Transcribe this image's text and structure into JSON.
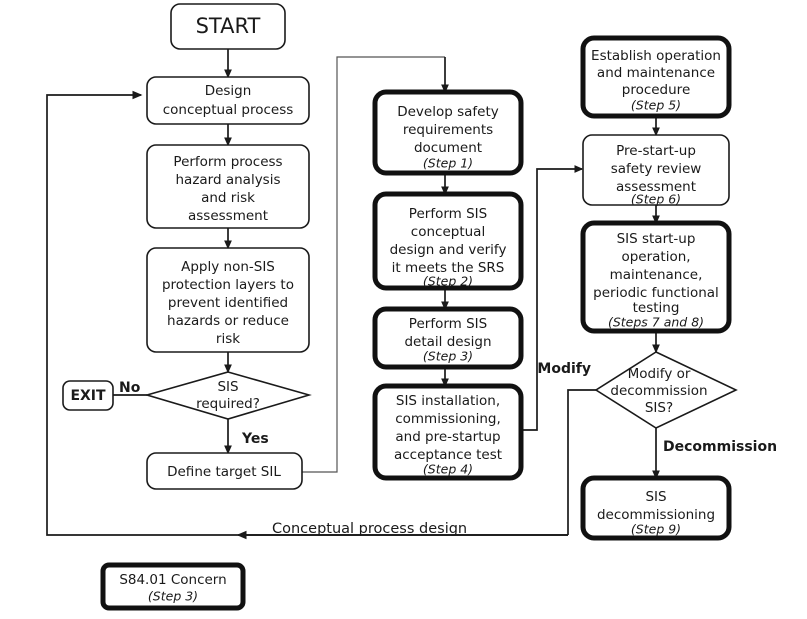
{
  "title": "SIS Safety Lifecycle Flowchart",
  "colors": {
    "background": "#ffffff",
    "stroke": "#1a1a1a",
    "thick_stroke": "#111111",
    "fill": "#ffffff",
    "text": "#1a1a1a"
  },
  "nodes": {
    "start": {
      "label": "START",
      "shape": "rounded-rect",
      "border": "thin"
    },
    "design_conceptual": {
      "lines": [
        "Design",
        "conceptual process"
      ],
      "shape": "rounded-rect",
      "border": "thin"
    },
    "hazard_analysis": {
      "lines": [
        "Perform process",
        "hazard analysis",
        "and risk",
        "assessment"
      ],
      "shape": "rounded-rect",
      "border": "thin"
    },
    "protection_layers": {
      "lines": [
        "Apply non-SIS",
        "protection layers to",
        "prevent identified",
        "hazards or reduce",
        "risk"
      ],
      "shape": "rounded-rect",
      "border": "thin"
    },
    "sis_required": {
      "lines": [
        "SIS",
        "required?"
      ],
      "shape": "diamond",
      "border": "thin"
    },
    "exit": {
      "label": "EXIT",
      "shape": "rounded-rect",
      "border": "thin"
    },
    "define_target_sil": {
      "lines": [
        "Define target SIL"
      ],
      "shape": "rounded-rect",
      "border": "thin"
    },
    "develop_srs": {
      "lines": [
        "Develop safety",
        "requirements",
        "document"
      ],
      "step": "(Step 1)",
      "shape": "rounded-rect",
      "border": "thick"
    },
    "sis_conceptual_design": {
      "lines": [
        "Perform SIS",
        "conceptual",
        "design and verify",
        "it meets the SRS"
      ],
      "step": "(Step 2)",
      "shape": "rounded-rect",
      "border": "thick"
    },
    "sis_detail_design": {
      "lines": [
        "Perform SIS",
        "detail design"
      ],
      "step": "(Step 3)",
      "shape": "rounded-rect",
      "border": "thick"
    },
    "sis_installation": {
      "lines": [
        "SIS installation,",
        "commissioning,",
        "and pre-startup",
        "acceptance test"
      ],
      "step": "(Step 4)",
      "shape": "rounded-rect",
      "border": "thick"
    },
    "operation_maintenance": {
      "lines": [
        "Establish operation",
        "and maintenance",
        "procedure"
      ],
      "step": "(Step 5)",
      "shape": "rounded-rect",
      "border": "thick"
    },
    "pre_startup_review": {
      "lines": [
        "Pre-start-up",
        "safety review",
        "assessment"
      ],
      "step": "(Step 6)",
      "shape": "rounded-rect",
      "border": "thin"
    },
    "sis_startup_operation": {
      "lines": [
        "SIS start-up",
        "operation,",
        "maintenance,",
        "periodic functional",
        "testing"
      ],
      "step": "(Steps 7 and 8)",
      "shape": "rounded-rect",
      "border": "thick"
    },
    "modify_or_decommission": {
      "lines": [
        "Modify or",
        "decommission",
        "SIS?"
      ],
      "shape": "diamond",
      "border": "thin"
    },
    "sis_decommissioning": {
      "lines": [
        "SIS",
        "decommissioning"
      ],
      "step": "(Step 9)",
      "shape": "rounded-rect",
      "border": "thick"
    },
    "legend_concern": {
      "lines": [
        "S84.01 Concern"
      ],
      "step": "(Step 3)",
      "shape": "rounded-rect",
      "border": "thick"
    }
  },
  "edge_labels": {
    "no": "No",
    "yes": "Yes",
    "modify": "Modify",
    "decommission": "Decommission",
    "feedback": "Conceptual process design"
  }
}
